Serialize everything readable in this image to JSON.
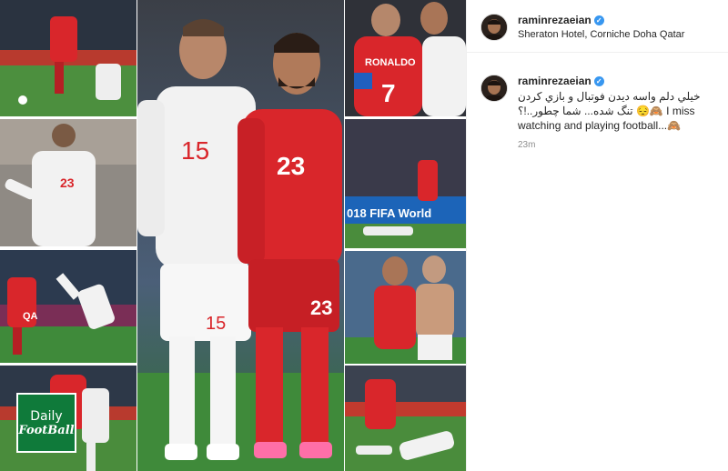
{
  "post": {
    "username": "raminrezaeian",
    "location": "Sheraton Hotel, Corniche Doha Qatar",
    "verified_icon": "verified-badge-icon"
  },
  "caption": {
    "username": "raminrezaeian",
    "text": "خيلي دلم واسه ديدن فوتبال و بازي كردن تنگ شده... شما چطور..!؟ 😔🙈 I miss watching and playing football...🙈",
    "time": "23m"
  },
  "collage": {
    "jersey_center_left": "15",
    "jersey_center_right": "23",
    "jersey_top_right": "RONALDO",
    "jersey_top_right_number": "7",
    "watermark_line1": "Daily",
    "watermark_line2": "FootBall",
    "banner_text": "018 FIFA World"
  },
  "colors": {
    "iran_red": "#d9262b",
    "spain_white": "#f2f2f2",
    "pitch_green": "#3f8a3a",
    "verified_blue": "#3897f0",
    "logo_green": "#0f7a3a"
  }
}
